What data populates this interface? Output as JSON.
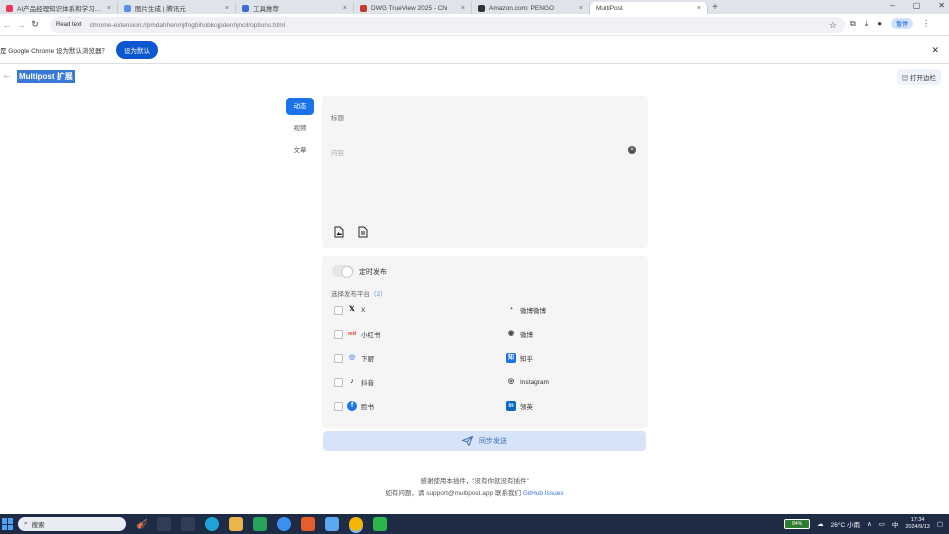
{
  "browser": {
    "tabs": [
      {
        "label": "AI产品经理知识体系和学习路线",
        "color": "#e8365d"
      },
      {
        "label": "图片生成 | 腾讯元",
        "color": "#5a8dee"
      },
      {
        "label": "工具推荐",
        "color": "#3b6fd4"
      },
      {
        "label": "DWG TrueView 2025 - Chi",
        "color": "#c0392b"
      },
      {
        "label": "Amazon.com: PENGO",
        "color": "#333333"
      },
      {
        "label": "MultiPost",
        "color": "#ffffff"
      }
    ],
    "new_tab": "+",
    "address": {
      "security": "Read text",
      "url": "chrome-extension://pmdahhenmjlfngbihobkojpdenhjncil/options.html",
      "star": "☆"
    },
    "profile_label": "暂停",
    "infobar": {
      "text": "是 Google Chrome 设为默认浏览器？",
      "button": "设为默认"
    }
  },
  "page": {
    "back": "←",
    "title": "Multipost 扩展",
    "sidebar_toggle": "打开边栏",
    "side_tabs": [
      {
        "label": "动态",
        "active": true
      },
      {
        "label": "视频",
        "active": false
      },
      {
        "label": "文章",
        "active": false
      }
    ],
    "editor": {
      "title_placeholder": "标题",
      "content_placeholder": "内容",
      "clear": "×"
    },
    "sync_toggle_label": "定时发布",
    "select_prefix": "选择发布平台",
    "select_suffix": "（2）",
    "platforms_left": [
      {
        "label": "X",
        "icon": "𝕏",
        "icon_color": "#000000"
      },
      {
        "label": "小红书",
        "icon": "red",
        "icon_color": "#e02e24"
      },
      {
        "label": "下厨",
        "icon": "◎",
        "icon_color": "#5a8dee"
      },
      {
        "label": "抖音",
        "icon": "♪",
        "icon_color": "#000000"
      },
      {
        "label": "脸书",
        "icon": "f",
        "icon_color": "#1877f2"
      }
    ],
    "platforms_right": [
      {
        "label": "微博微博",
        "icon": "◔",
        "icon_color": "#333333"
      },
      {
        "label": "微博",
        "icon": "◉",
        "icon_color": "#444444"
      },
      {
        "label": "知乎",
        "icon": "知",
        "icon_color": "#1a73e8"
      },
      {
        "label": "Instagram",
        "icon": "◎",
        "icon_color": "#333333"
      },
      {
        "label": "领英",
        "icon": "in",
        "icon_color": "#0a66c2"
      }
    ],
    "publish_label": "同步发送",
    "footer_line1": "感谢使用本插件，“没有你就没有插件”",
    "footer_line2_prefix": "如有问题，请 support@multipost.app 联系我们",
    "footer_line2_link": "GitHub Issues"
  },
  "taskbar": {
    "search_placeholder": "搜索",
    "battery": "84%",
    "weather": "26°C 小雨",
    "ime": "中",
    "time": "17:34",
    "date": "2024/9/13"
  }
}
